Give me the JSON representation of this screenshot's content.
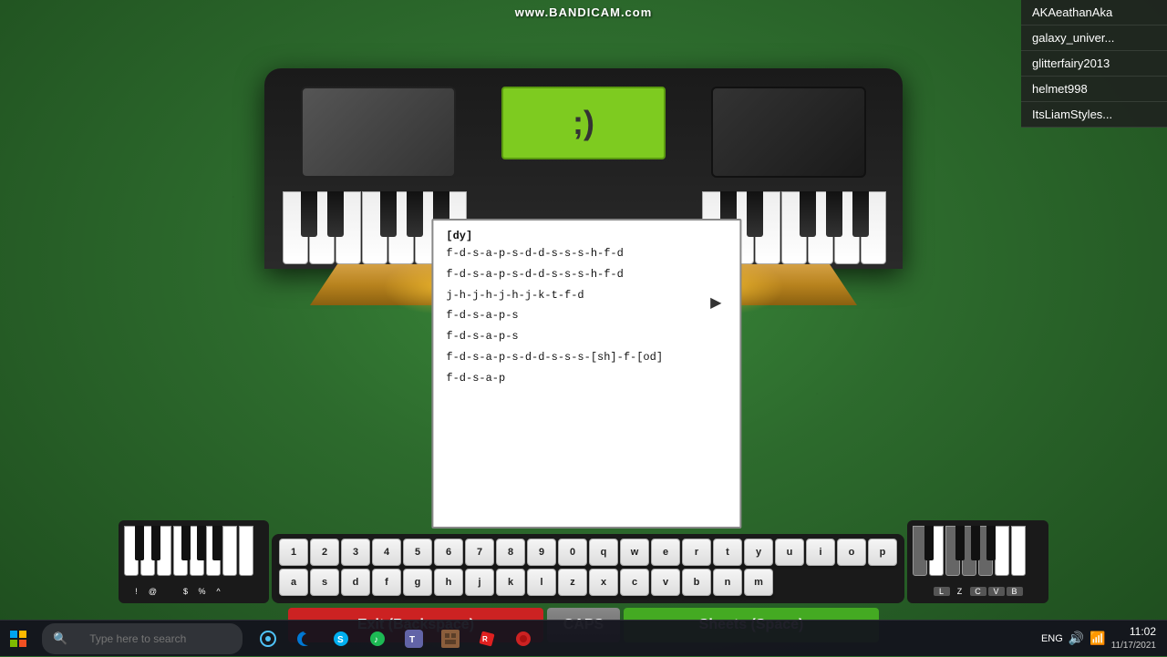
{
  "watermark": "www.BANDICAM.com",
  "display_center": ";)",
  "players": [
    {
      "name": "AKAeathanAka"
    },
    {
      "name": "galaxy_univer..."
    },
    {
      "name": "glitterfairy2013"
    },
    {
      "name": "helmet998"
    },
    {
      "name": "ItsLiamStyles..."
    }
  ],
  "sheet": {
    "title": "[dy]",
    "lines": [
      "f-d-s-a-p-s-d-d-s-s-s-h-f-d",
      "f-d-s-a-p-s-d-d-s-s-s-h-f-d",
      "j-h-j-h-j-h-j-k-t-f-d",
      "f-d-s-a-p-s",
      "f-d-s-a-p-s",
      "f-d-s-a-p-s-d-d-s-s-s-[sh]-f-[od]",
      "f-d-s-a-p"
    ]
  },
  "bottom_keyboard": {
    "black_row_left": [
      "!",
      "@",
      "$",
      "%",
      "^"
    ],
    "black_spacers_left": [
      false,
      true,
      false,
      false,
      true
    ],
    "white_row_left": [
      "1",
      "2",
      "3",
      "4",
      "5",
      "6",
      "7",
      "8",
      "9",
      "0",
      "q",
      "w",
      "e",
      "r",
      "t",
      "y",
      "u",
      "i",
      "o",
      "p"
    ],
    "white_row_right": [
      "a",
      "s",
      "d",
      "f",
      "g",
      "h",
      "j",
      "k",
      "l",
      "z",
      "x",
      "c",
      "v",
      "b",
      "n",
      "m"
    ],
    "black_row_right_labels": [
      "L",
      "Z",
      "C",
      "V",
      "B"
    ]
  },
  "buttons": {
    "exit_label": "Exit (Backspace)",
    "caps_label": "CAPS",
    "sheets_label": "Sheets (Space)"
  },
  "taskbar": {
    "search_placeholder": "Type here to search",
    "time": "11:02",
    "date": "11/17/2021",
    "language": "ENG"
  },
  "colors": {
    "grass": "#2d6b2d",
    "piano_body": "#1a1a1a",
    "display_green": "#7ecb20",
    "btn_exit": "#cc2222",
    "btn_caps": "#777777",
    "btn_sheets": "#44aa22"
  }
}
